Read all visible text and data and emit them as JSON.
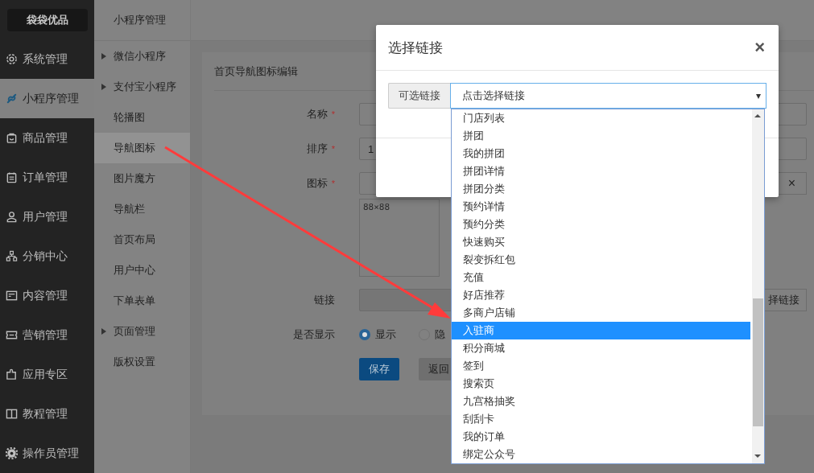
{
  "brand": "袋袋优品",
  "sidebar": {
    "items": [
      {
        "label": "系统管理",
        "selected": false
      },
      {
        "label": "小程序管理",
        "selected": true
      },
      {
        "label": "商品管理",
        "selected": false
      },
      {
        "label": "订单管理",
        "selected": false
      },
      {
        "label": "用户管理",
        "selected": false
      },
      {
        "label": "分销中心",
        "selected": false
      },
      {
        "label": "内容管理",
        "selected": false
      },
      {
        "label": "营销管理",
        "selected": false
      },
      {
        "label": "应用专区",
        "selected": false
      },
      {
        "label": "教程管理",
        "selected": false
      },
      {
        "label": "操作员管理",
        "selected": false
      }
    ]
  },
  "submenu": {
    "title": "小程序管理",
    "items": [
      {
        "label": "微信小程序",
        "expandable": true,
        "selected": false
      },
      {
        "label": "支付宝小程序",
        "expandable": true,
        "selected": false
      },
      {
        "label": "轮播图",
        "expandable": false,
        "selected": false
      },
      {
        "label": "导航图标",
        "expandable": false,
        "selected": true
      },
      {
        "label": "图片魔方",
        "expandable": false,
        "selected": false
      },
      {
        "label": "导航栏",
        "expandable": false,
        "selected": false
      },
      {
        "label": "首页布局",
        "expandable": false,
        "selected": false
      },
      {
        "label": "用户中心",
        "expandable": false,
        "selected": false
      },
      {
        "label": "下单表单",
        "expandable": false,
        "selected": false
      },
      {
        "label": "页面管理",
        "expandable": true,
        "selected": false
      },
      {
        "label": "版权设置",
        "expandable": false,
        "selected": false
      }
    ]
  },
  "form": {
    "title": "首页导航图标编辑",
    "name": {
      "label": "名称",
      "required_mark": "*"
    },
    "sort": {
      "label": "排序",
      "required_mark": "*",
      "value": "1"
    },
    "icon": {
      "label": "图标",
      "required_mark": "*",
      "clear": "×",
      "image_hint": "88×88"
    },
    "link": {
      "label": "链接",
      "button": "择链接"
    },
    "display": {
      "label": "是否显示",
      "options": [
        {
          "label": "显示",
          "selected": true
        },
        {
          "label": "隐",
          "selected": false
        }
      ]
    },
    "buttons": [
      {
        "label": "保存",
        "kind": "primary"
      },
      {
        "label": "返回",
        "kind": "default"
      }
    ]
  },
  "dialog": {
    "title": "选择链接",
    "close": "×",
    "addon": "可选链接",
    "select": "点击选择链接",
    "caret": "▾",
    "options": [
      {
        "label": "门店列表",
        "selected": false
      },
      {
        "label": "拼团",
        "selected": false
      },
      {
        "label": "我的拼团",
        "selected": false
      },
      {
        "label": "拼团详情",
        "selected": false
      },
      {
        "label": "拼团分类",
        "selected": false
      },
      {
        "label": "预约详情",
        "selected": false
      },
      {
        "label": "预约分类",
        "selected": false
      },
      {
        "label": "快速购买",
        "selected": false
      },
      {
        "label": "裂变拆红包",
        "selected": false
      },
      {
        "label": "充值",
        "selected": false
      },
      {
        "label": "好店推荐",
        "selected": false
      },
      {
        "label": "多商户店铺",
        "selected": false
      },
      {
        "label": "入驻商",
        "selected": true
      },
      {
        "label": "积分商城",
        "selected": false
      },
      {
        "label": "签到",
        "selected": false
      },
      {
        "label": "搜索页",
        "selected": false
      },
      {
        "label": "九宫格抽奖",
        "selected": false
      },
      {
        "label": "刮刮卡",
        "selected": false
      },
      {
        "label": "我的订单",
        "selected": false
      },
      {
        "label": "绑定公众号",
        "selected": false
      }
    ]
  }
}
